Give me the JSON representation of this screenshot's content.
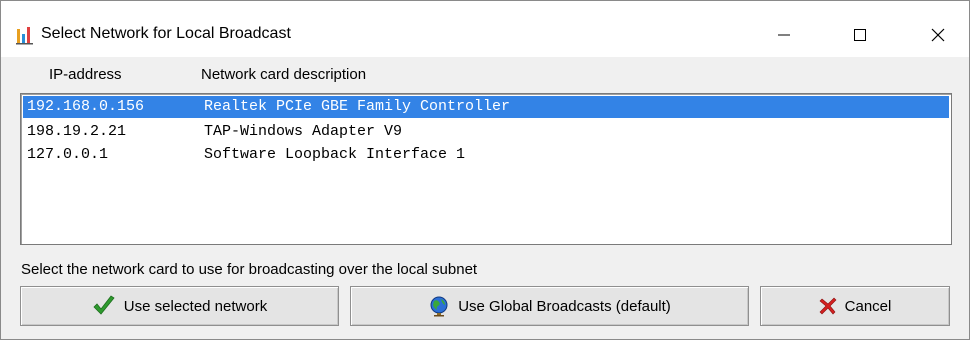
{
  "window": {
    "title": "Select Network for Local Broadcast",
    "icon": "chart-bars-icon"
  },
  "caption_buttons": {
    "minimize": "minimize-icon",
    "maximize": "maximize-icon",
    "close": "close-icon"
  },
  "list": {
    "headers": {
      "ip": "IP-address",
      "description": "Network card  description"
    },
    "rows": [
      {
        "ip": "192.168.0.156",
        "description": "Realtek PCIe GBE Family Controller",
        "selected": true
      },
      {
        "ip": "198.19.2.21",
        "description": "TAP-Windows Adapter V9",
        "selected": false
      },
      {
        "ip": "127.0.0.1",
        "description": "Software Loopback Interface 1",
        "selected": false
      }
    ],
    "selection_color": "#3383e6"
  },
  "hint": "Select the network card to use for broadcasting over the local subnet",
  "buttons": {
    "use_selected": {
      "label": "Use selected network",
      "icon": "checkmark-icon"
    },
    "use_global": {
      "label": "Use Global Broadcasts (default)",
      "icon": "globe-icon"
    },
    "cancel": {
      "label": "Cancel",
      "icon": "red-x-icon"
    }
  }
}
